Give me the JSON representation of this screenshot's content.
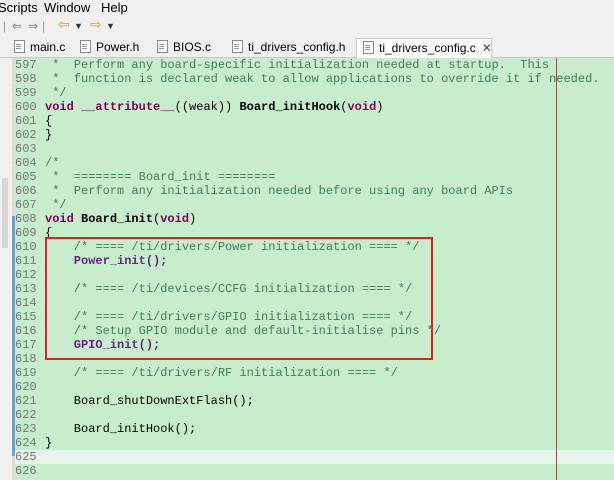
{
  "menu": {
    "scripts": "Scripts",
    "window": "Window",
    "help": "Help"
  },
  "tabs": [
    {
      "label": "main.c"
    },
    {
      "label": "Power.h"
    },
    {
      "label": "BIOS.c"
    },
    {
      "label": "ti_drivers_config.h"
    },
    {
      "label": "ti_drivers_config.c",
      "active": true
    }
  ],
  "editor": {
    "lines": [
      {
        "num": "597",
        "text": " *  Perform any board-specific initialization needed at startup.  This"
      },
      {
        "num": "598",
        "text": " *  function is declared weak to allow applications to override it if needed."
      },
      {
        "num": "599",
        "text": " */"
      },
      {
        "num": "600",
        "text": "void __attribute__((weak)) Board_initHook(void)"
      },
      {
        "num": "601",
        "text": "{"
      },
      {
        "num": "602",
        "text": "}"
      },
      {
        "num": "603",
        "text": ""
      },
      {
        "num": "604",
        "text": "/*"
      },
      {
        "num": "605",
        "text": " *  ======== Board_init ========"
      },
      {
        "num": "606",
        "text": " *  Perform any initialization needed before using any board APIs"
      },
      {
        "num": "607",
        "text": " */"
      },
      {
        "num": "608",
        "text": "void Board_init(void)"
      },
      {
        "num": "609",
        "text": "{"
      },
      {
        "num": "610",
        "text": "    /* ==== /ti/drivers/Power initialization ==== */"
      },
      {
        "num": "611",
        "text": "    Power_init();"
      },
      {
        "num": "612",
        "text": ""
      },
      {
        "num": "613",
        "text": "    /* ==== /ti/devices/CCFG initialization ==== */"
      },
      {
        "num": "614",
        "text": ""
      },
      {
        "num": "615",
        "text": "    /* ==== /ti/drivers/GPIO initialization ==== */"
      },
      {
        "num": "616",
        "text": "    /* Setup GPIO module and default-initialise pins */"
      },
      {
        "num": "617",
        "text": "    GPIO_init();"
      },
      {
        "num": "618",
        "text": ""
      },
      {
        "num": "619",
        "text": "    /* ==== /ti/drivers/RF initialization ==== */"
      },
      {
        "num": "620",
        "text": ""
      },
      {
        "num": "621",
        "text": "    Board_shutDownExtFlash();"
      },
      {
        "num": "622",
        "text": ""
      },
      {
        "num": "623",
        "text": "    Board_initHook();"
      },
      {
        "num": "624",
        "text": "}"
      },
      {
        "num": "625",
        "text": ""
      },
      {
        "num": "626",
        "text": ""
      }
    ]
  }
}
